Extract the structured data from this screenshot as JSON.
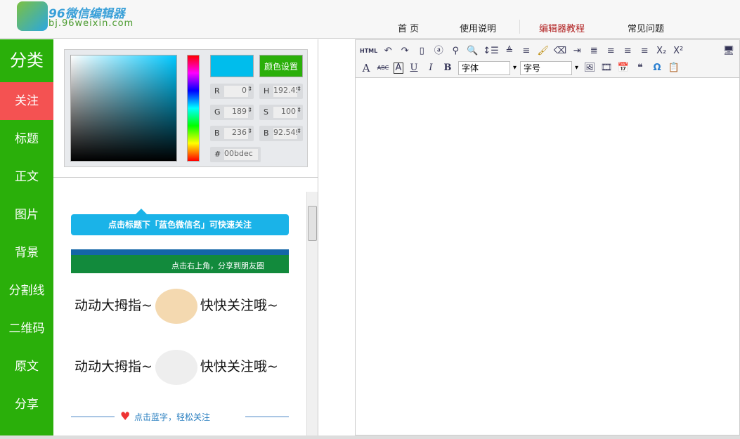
{
  "header": {
    "logo_title": "96微信编辑器",
    "logo_url": "bj.96weixin.com",
    "nav": [
      "首 页",
      "使用说明",
      "编辑器教程",
      "常见问题"
    ],
    "active_nav": 2
  },
  "sidebar": {
    "items": [
      "分类",
      "关注",
      "标题",
      "正文",
      "图片",
      "背景",
      "分割线",
      "二维码",
      "原文",
      "分享"
    ],
    "active": 1
  },
  "color_picker": {
    "button": "颜色设置",
    "swatch": "#00bdec",
    "R": "0",
    "G": "189",
    "B": "236",
    "H": "192.457",
    "S": "100",
    "Bv": "92.5490",
    "hex": "00bdec",
    "labels": {
      "r": "R",
      "g": "G",
      "b": "B",
      "h": "H",
      "s": "S",
      "bv": "B",
      "hash": "#"
    }
  },
  "templates": {
    "tip": "点击标题下「蓝色微信名」可快速关注",
    "share_band": "点击右上角，分享到朋友圈",
    "meme1": {
      "left": "动动大拇指~",
      "right": "快快关注哦~"
    },
    "meme2": {
      "left": "动动大拇指~",
      "right": "快快关注哦~"
    },
    "divider": "点击蓝字，轻松关注"
  },
  "toolbar": {
    "html": "HTML",
    "font_family": "字体",
    "font_size": "字号",
    "bold": "B",
    "italic": "I",
    "underline": "U",
    "font_color": "A",
    "border": "A",
    "strike": "ABC",
    "quote": "❝",
    "omega": "Ω",
    "sub": "X₂",
    "sup": "X²"
  }
}
